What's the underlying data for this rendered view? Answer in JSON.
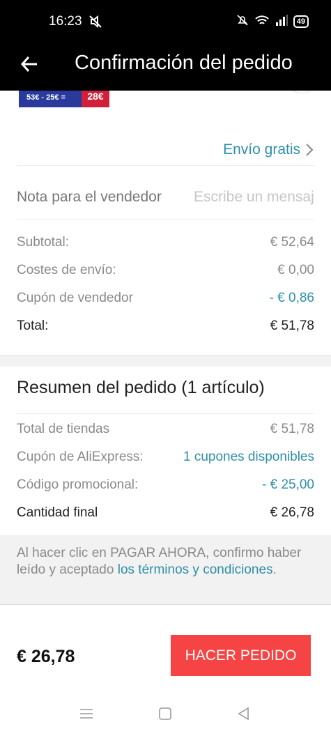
{
  "status_bar": {
    "time": "16:23",
    "battery": "49"
  },
  "header": {
    "title": "Confirmación del pedido"
  },
  "product": {
    "thumb_text": "53€ - 25€ =",
    "thumb_price": "28€"
  },
  "shipping": {
    "label": "Envío gratis"
  },
  "note": {
    "label": "Nota para el vendedor",
    "placeholder": "Escribe un mensaje"
  },
  "price_lines": {
    "subtotal_label": "Subtotal:",
    "subtotal_value": "€ 52,64",
    "shipping_label": "Costes de envío:",
    "shipping_value": "€ 0,00",
    "coupon_label": "Cupón de vendedor",
    "coupon_value": "- € 0,86",
    "total_label": "Total:",
    "total_value": "€ 51,78"
  },
  "summary": {
    "title": "Resumen del pedido (1 artículo)",
    "stores_label": "Total de tiendas",
    "stores_value": "€ 51,78",
    "ae_coupon_label": "Cupón de AliExpress:",
    "ae_coupon_value": "1 cupones disponibles",
    "promo_label": "Código promocional:",
    "promo_value": "- € 25,00",
    "final_label": "Cantidad final",
    "final_value": "€ 26,78"
  },
  "terms": {
    "text_before": "Al hacer clic en PAGAR AHORA, confirmo haber leído y aceptado ",
    "link_text": "los términos y condiciones",
    "text_after": "."
  },
  "bottom": {
    "final_price": "€ 26,78",
    "order_button": "HACER PEDIDO"
  },
  "colors": {
    "accent_blue": "#2e8fa8",
    "order_red": "#f64444"
  }
}
